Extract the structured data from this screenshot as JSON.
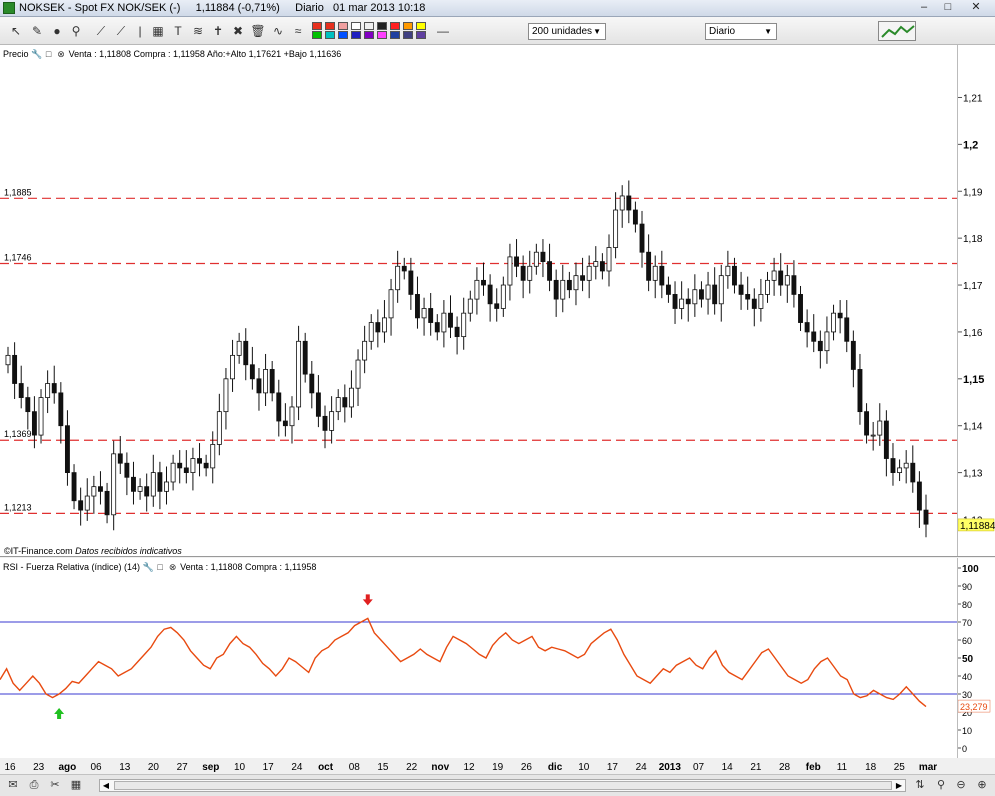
{
  "window": {
    "title": "NOKSEK - Spot FX NOK/SEK (-)",
    "quote": "1,11884 (-0,71%)",
    "period_label": "Diario",
    "timestamp": "01 mar 2013 10:18"
  },
  "toolbar": {
    "units_select": "200 unidades",
    "period_select": "Diario",
    "swatch_colors": [
      "#e6301e",
      "#e6301e",
      "#f0a0a0",
      "#ffffff",
      "#f0f0f0",
      "#222222",
      "#ff2020",
      "#ff9900",
      "#ffff00",
      "#00c000",
      "#00c0c0",
      "#0050ff",
      "#2020c0",
      "#8000c0",
      "#ff40ff",
      "#2040a0",
      "#404080",
      "#6040a0"
    ]
  },
  "price_panel": {
    "header_label": "Precio",
    "header_info": "Venta : 1,11808 Compra : 1,11958  Año:+Alto 1,17621 +Bajo 1,11636",
    "footer_source": "©IT-Finance.com",
    "footer_note": "Datos recibidos indicativos",
    "current_price_label": "1,11884",
    "current_price": 1.11884
  },
  "rsi_panel": {
    "header_label": "RSI - Fuerza Relativa (índice) (14)",
    "header_info": "Venta : 1,11808 Compra : 1,11958",
    "current_value_label": "23,279",
    "current_value": 23.279
  },
  "colors": {
    "up_candle": "#ffffff",
    "down_candle": "#111111",
    "level_line": "#e03030",
    "rsi_line": "#e84a10",
    "rsi_band": "#3a3ad0",
    "arrow_down": "#e02020",
    "arrow_up": "#20c020",
    "current_price_bg": "#ffff66"
  },
  "chart_data": [
    {
      "type": "candlestick",
      "y_ticks": [
        "1,21",
        "1,2",
        "1,19",
        "1,18",
        "1,17",
        "1,16",
        "1,15",
        "1,14",
        "1,13",
        "1,12"
      ],
      "y_tick_values": [
        1.21,
        1.2,
        1.19,
        1.18,
        1.17,
        1.16,
        1.15,
        1.14,
        1.13,
        1.12
      ],
      "ylim": [
        1.112,
        1.2165
      ],
      "levels": [
        {
          "label": "1,1885",
          "value": 1.1885
        },
        {
          "label": "1,1746",
          "value": 1.1746
        },
        {
          "label": "1,1369",
          "value": 1.1369
        },
        {
          "label": "1,1213",
          "value": 1.1213
        }
      ],
      "x_tick_labels": [
        "16",
        "23",
        "ago",
        "06",
        "13",
        "20",
        "27",
        "sep",
        "10",
        "17",
        "24",
        "oct",
        "08",
        "15",
        "22",
        "nov",
        "12",
        "19",
        "26",
        "dic",
        "10",
        "17",
        "24",
        "2013",
        "07",
        "14",
        "21",
        "28",
        "feb",
        "11",
        "18",
        "25",
        "mar"
      ],
      "bold_x_labels": [
        "ago",
        "sep",
        "oct",
        "nov",
        "dic",
        "2013",
        "feb",
        "mar"
      ],
      "closes": [
        1.155,
        1.149,
        1.146,
        1.143,
        1.138,
        1.146,
        1.149,
        1.147,
        1.14,
        1.13,
        1.124,
        1.122,
        1.125,
        1.127,
        1.126,
        1.121,
        1.134,
        1.132,
        1.129,
        1.126,
        1.127,
        1.125,
        1.13,
        1.126,
        1.128,
        1.132,
        1.131,
        1.13,
        1.133,
        1.132,
        1.131,
        1.136,
        1.143,
        1.15,
        1.155,
        1.158,
        1.153,
        1.15,
        1.147,
        1.152,
        1.147,
        1.141,
        1.14,
        1.144,
        1.158,
        1.151,
        1.147,
        1.142,
        1.139,
        1.143,
        1.146,
        1.144,
        1.148,
        1.154,
        1.158,
        1.162,
        1.16,
        1.163,
        1.169,
        1.174,
        1.173,
        1.168,
        1.163,
        1.165,
        1.162,
        1.16,
        1.164,
        1.161,
        1.159,
        1.164,
        1.167,
        1.171,
        1.17,
        1.166,
        1.165,
        1.17,
        1.176,
        1.174,
        1.171,
        1.174,
        1.177,
        1.175,
        1.171,
        1.167,
        1.171,
        1.169,
        1.172,
        1.171,
        1.174,
        1.175,
        1.173,
        1.178,
        1.186,
        1.189,
        1.186,
        1.183,
        1.177,
        1.171,
        1.174,
        1.17,
        1.168,
        1.165,
        1.167,
        1.166,
        1.169,
        1.167,
        1.17,
        1.166,
        1.172,
        1.174,
        1.17,
        1.168,
        1.167,
        1.165,
        1.168,
        1.171,
        1.173,
        1.17,
        1.172,
        1.168,
        1.162,
        1.16,
        1.158,
        1.156,
        1.16,
        1.164,
        1.163,
        1.158,
        1.152,
        1.143,
        1.138,
        1.138,
        1.141,
        1.133,
        1.13,
        1.131,
        1.132,
        1.128,
        1.122,
        1.119
      ]
    },
    {
      "type": "line",
      "name": "RSI - Fuerza Relativa (índice) (14)",
      "y_ticks": [
        "100",
        "90",
        "80",
        "70",
        "60",
        "50",
        "40",
        "30",
        "20",
        "10",
        "0"
      ],
      "y_tick_values": [
        100,
        90,
        80,
        70,
        60,
        50,
        40,
        30,
        20,
        10,
        0
      ],
      "ylim": [
        0,
        100
      ],
      "bands": [
        30,
        70
      ],
      "signals": [
        {
          "type": "buy",
          "index": 9
        },
        {
          "type": "sell",
          "index": 56
        },
        {
          "type": "buy",
          "index": 145
        }
      ],
      "values": [
        38,
        44,
        36,
        32,
        36,
        40,
        36,
        30,
        28,
        30,
        33,
        37,
        36,
        40,
        44,
        48,
        46,
        44,
        40,
        42,
        44,
        48,
        52,
        56,
        62,
        66,
        67,
        64,
        60,
        54,
        50,
        46,
        44,
        50,
        52,
        58,
        62,
        58,
        56,
        52,
        47,
        44,
        40,
        44,
        50,
        48,
        45,
        42,
        50,
        54,
        56,
        60,
        62,
        64,
        68,
        70,
        72,
        64,
        60,
        56,
        52,
        48,
        50,
        52,
        55,
        52,
        50,
        48,
        56,
        62,
        60,
        58,
        55,
        52,
        50,
        57,
        61,
        64,
        60,
        58,
        60,
        62,
        56,
        54,
        56,
        55,
        54,
        52,
        50,
        52,
        58,
        61,
        64,
        66,
        60,
        52,
        46,
        40,
        38,
        36,
        40,
        44,
        42,
        46,
        48,
        50,
        46,
        44,
        50,
        54,
        46,
        42,
        40,
        38,
        43,
        48,
        53,
        55,
        50,
        45,
        40,
        38,
        36,
        38,
        44,
        48,
        50,
        45,
        40,
        38,
        30,
        28,
        29,
        32,
        30,
        28,
        27,
        30,
        34,
        30,
        26,
        23
      ]
    }
  ]
}
